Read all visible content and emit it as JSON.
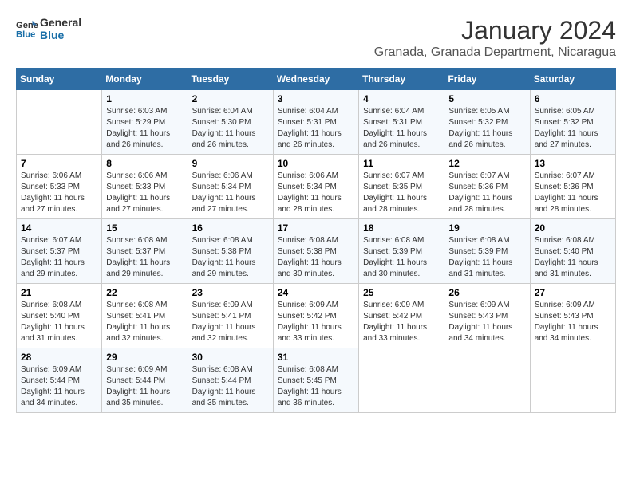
{
  "header": {
    "logo_line1": "General",
    "logo_line2": "Blue",
    "month": "January 2024",
    "location": "Granada, Granada Department, Nicaragua"
  },
  "weekdays": [
    "Sunday",
    "Monday",
    "Tuesday",
    "Wednesday",
    "Thursday",
    "Friday",
    "Saturday"
  ],
  "weeks": [
    [
      {
        "day": "",
        "sunrise": "",
        "sunset": "",
        "daylight": ""
      },
      {
        "day": "1",
        "sunrise": "Sunrise: 6:03 AM",
        "sunset": "Sunset: 5:29 PM",
        "daylight": "Daylight: 11 hours and 26 minutes."
      },
      {
        "day": "2",
        "sunrise": "Sunrise: 6:04 AM",
        "sunset": "Sunset: 5:30 PM",
        "daylight": "Daylight: 11 hours and 26 minutes."
      },
      {
        "day": "3",
        "sunrise": "Sunrise: 6:04 AM",
        "sunset": "Sunset: 5:31 PM",
        "daylight": "Daylight: 11 hours and 26 minutes."
      },
      {
        "day": "4",
        "sunrise": "Sunrise: 6:04 AM",
        "sunset": "Sunset: 5:31 PM",
        "daylight": "Daylight: 11 hours and 26 minutes."
      },
      {
        "day": "5",
        "sunrise": "Sunrise: 6:05 AM",
        "sunset": "Sunset: 5:32 PM",
        "daylight": "Daylight: 11 hours and 26 minutes."
      },
      {
        "day": "6",
        "sunrise": "Sunrise: 6:05 AM",
        "sunset": "Sunset: 5:32 PM",
        "daylight": "Daylight: 11 hours and 27 minutes."
      }
    ],
    [
      {
        "day": "7",
        "sunrise": "Sunrise: 6:06 AM",
        "sunset": "Sunset: 5:33 PM",
        "daylight": "Daylight: 11 hours and 27 minutes."
      },
      {
        "day": "8",
        "sunrise": "Sunrise: 6:06 AM",
        "sunset": "Sunset: 5:33 PM",
        "daylight": "Daylight: 11 hours and 27 minutes."
      },
      {
        "day": "9",
        "sunrise": "Sunrise: 6:06 AM",
        "sunset": "Sunset: 5:34 PM",
        "daylight": "Daylight: 11 hours and 27 minutes."
      },
      {
        "day": "10",
        "sunrise": "Sunrise: 6:06 AM",
        "sunset": "Sunset: 5:34 PM",
        "daylight": "Daylight: 11 hours and 28 minutes."
      },
      {
        "day": "11",
        "sunrise": "Sunrise: 6:07 AM",
        "sunset": "Sunset: 5:35 PM",
        "daylight": "Daylight: 11 hours and 28 minutes."
      },
      {
        "day": "12",
        "sunrise": "Sunrise: 6:07 AM",
        "sunset": "Sunset: 5:36 PM",
        "daylight": "Daylight: 11 hours and 28 minutes."
      },
      {
        "day": "13",
        "sunrise": "Sunrise: 6:07 AM",
        "sunset": "Sunset: 5:36 PM",
        "daylight": "Daylight: 11 hours and 28 minutes."
      }
    ],
    [
      {
        "day": "14",
        "sunrise": "Sunrise: 6:07 AM",
        "sunset": "Sunset: 5:37 PM",
        "daylight": "Daylight: 11 hours and 29 minutes."
      },
      {
        "day": "15",
        "sunrise": "Sunrise: 6:08 AM",
        "sunset": "Sunset: 5:37 PM",
        "daylight": "Daylight: 11 hours and 29 minutes."
      },
      {
        "day": "16",
        "sunrise": "Sunrise: 6:08 AM",
        "sunset": "Sunset: 5:38 PM",
        "daylight": "Daylight: 11 hours and 29 minutes."
      },
      {
        "day": "17",
        "sunrise": "Sunrise: 6:08 AM",
        "sunset": "Sunset: 5:38 PM",
        "daylight": "Daylight: 11 hours and 30 minutes."
      },
      {
        "day": "18",
        "sunrise": "Sunrise: 6:08 AM",
        "sunset": "Sunset: 5:39 PM",
        "daylight": "Daylight: 11 hours and 30 minutes."
      },
      {
        "day": "19",
        "sunrise": "Sunrise: 6:08 AM",
        "sunset": "Sunset: 5:39 PM",
        "daylight": "Daylight: 11 hours and 31 minutes."
      },
      {
        "day": "20",
        "sunrise": "Sunrise: 6:08 AM",
        "sunset": "Sunset: 5:40 PM",
        "daylight": "Daylight: 11 hours and 31 minutes."
      }
    ],
    [
      {
        "day": "21",
        "sunrise": "Sunrise: 6:08 AM",
        "sunset": "Sunset: 5:40 PM",
        "daylight": "Daylight: 11 hours and 31 minutes."
      },
      {
        "day": "22",
        "sunrise": "Sunrise: 6:08 AM",
        "sunset": "Sunset: 5:41 PM",
        "daylight": "Daylight: 11 hours and 32 minutes."
      },
      {
        "day": "23",
        "sunrise": "Sunrise: 6:09 AM",
        "sunset": "Sunset: 5:41 PM",
        "daylight": "Daylight: 11 hours and 32 minutes."
      },
      {
        "day": "24",
        "sunrise": "Sunrise: 6:09 AM",
        "sunset": "Sunset: 5:42 PM",
        "daylight": "Daylight: 11 hours and 33 minutes."
      },
      {
        "day": "25",
        "sunrise": "Sunrise: 6:09 AM",
        "sunset": "Sunset: 5:42 PM",
        "daylight": "Daylight: 11 hours and 33 minutes."
      },
      {
        "day": "26",
        "sunrise": "Sunrise: 6:09 AM",
        "sunset": "Sunset: 5:43 PM",
        "daylight": "Daylight: 11 hours and 34 minutes."
      },
      {
        "day": "27",
        "sunrise": "Sunrise: 6:09 AM",
        "sunset": "Sunset: 5:43 PM",
        "daylight": "Daylight: 11 hours and 34 minutes."
      }
    ],
    [
      {
        "day": "28",
        "sunrise": "Sunrise: 6:09 AM",
        "sunset": "Sunset: 5:44 PM",
        "daylight": "Daylight: 11 hours and 34 minutes."
      },
      {
        "day": "29",
        "sunrise": "Sunrise: 6:09 AM",
        "sunset": "Sunset: 5:44 PM",
        "daylight": "Daylight: 11 hours and 35 minutes."
      },
      {
        "day": "30",
        "sunrise": "Sunrise: 6:08 AM",
        "sunset": "Sunset: 5:44 PM",
        "daylight": "Daylight: 11 hours and 35 minutes."
      },
      {
        "day": "31",
        "sunrise": "Sunrise: 6:08 AM",
        "sunset": "Sunset: 5:45 PM",
        "daylight": "Daylight: 11 hours and 36 minutes."
      },
      {
        "day": "",
        "sunrise": "",
        "sunset": "",
        "daylight": ""
      },
      {
        "day": "",
        "sunrise": "",
        "sunset": "",
        "daylight": ""
      },
      {
        "day": "",
        "sunrise": "",
        "sunset": "",
        "daylight": ""
      }
    ]
  ]
}
